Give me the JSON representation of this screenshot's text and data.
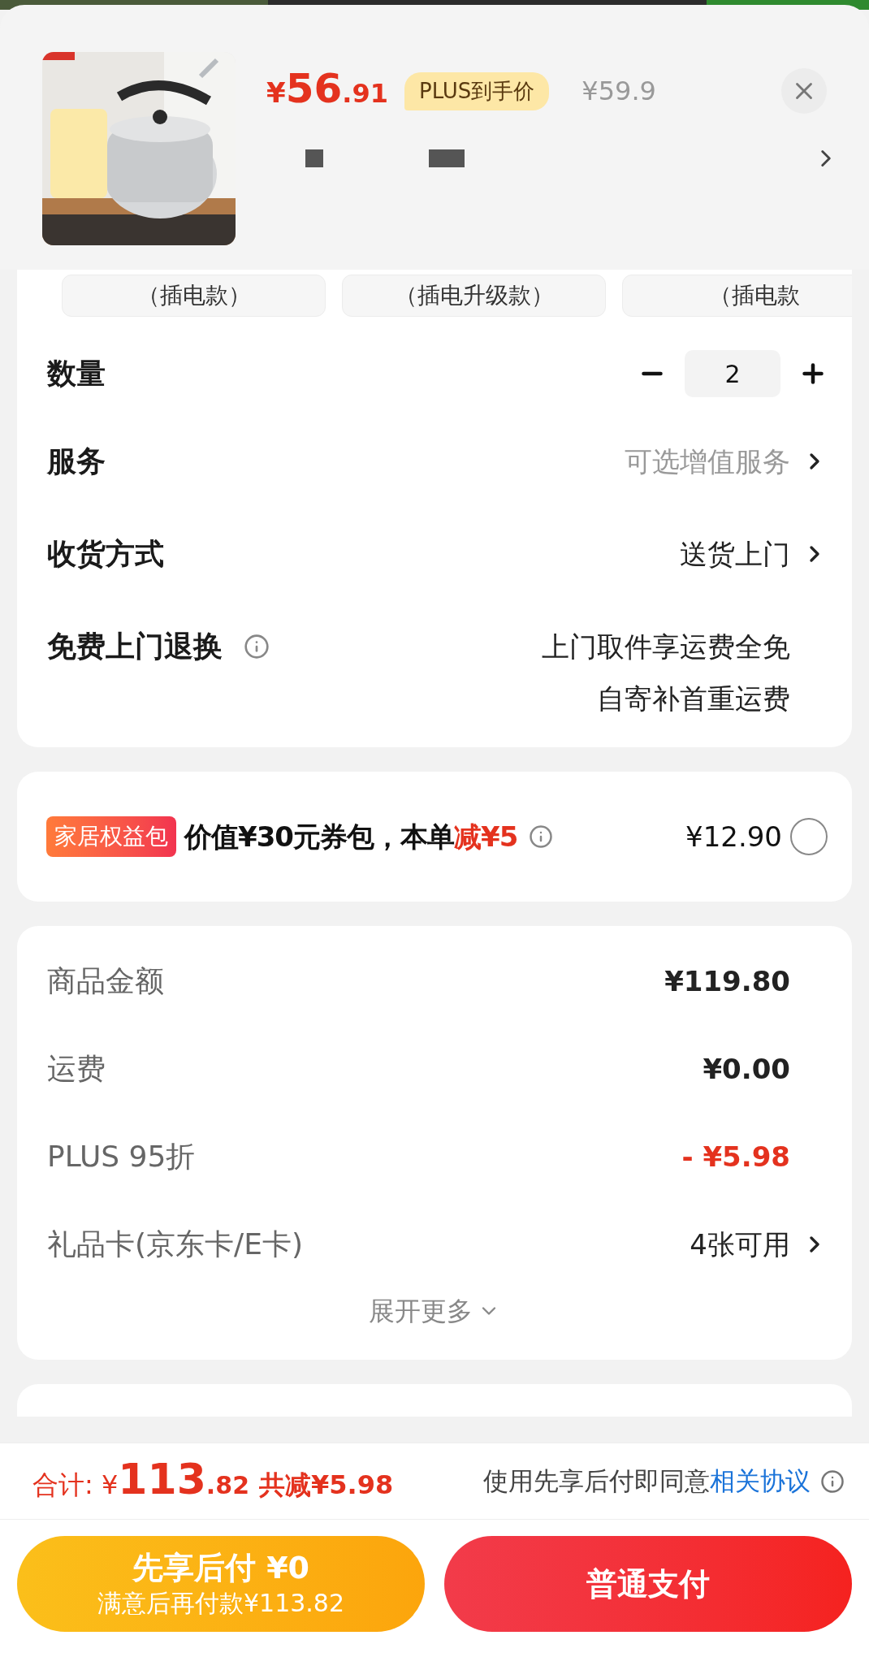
{
  "product": {
    "currency": "¥",
    "price_int": "56",
    "price_dec": ".91",
    "price_tag": "PLUS到手价",
    "original_price": "¥59.9"
  },
  "variants": [
    {
      "label": "（插电款）"
    },
    {
      "label": "（插电升级款）"
    },
    {
      "label": "（插电款"
    }
  ],
  "quantity": {
    "label": "数量",
    "value": "2"
  },
  "rows": [
    {
      "label": "服务",
      "kind": "link",
      "lines": [
        "可选增值服务"
      ],
      "muted": true
    },
    {
      "label": "收货方式",
      "kind": "link",
      "lines": [
        "送货上门"
      ],
      "muted": false
    },
    {
      "label": "免费上门退换",
      "kind": "info",
      "lines": [
        "上门取件享运费全免",
        "自寄补首重运费"
      ],
      "muted": false
    }
  ],
  "benefit": {
    "badge": "家居权益包",
    "text": "价值¥30元券包，本单",
    "highlight": "减¥5",
    "price": "¥12.90",
    "selected": false
  },
  "summary": {
    "rows": [
      {
        "label": "商品金额",
        "value": "¥119.80",
        "kind": "amount"
      },
      {
        "label": "运费",
        "value": "¥0.00",
        "kind": "amount"
      },
      {
        "label": "PLUS 95折",
        "value": "- ¥5.98",
        "kind": "discount"
      },
      {
        "label": "礼品卡(京东卡/E卡)",
        "value": "4张可用",
        "kind": "link"
      }
    ],
    "expand": "展开更多"
  },
  "footer": {
    "total_label": "合计:",
    "currency": "¥",
    "total_int": "113",
    "total_dec": ".82",
    "saved": "共减¥5.98",
    "agreement": "使用先享后付即同意",
    "agreement_link": "相关协议"
  },
  "buttons": [
    {
      "kind": "later",
      "title": "先享后付 ¥0",
      "subtitle": "满意后再付款¥113.82"
    },
    {
      "kind": "pay",
      "title": "普通支付"
    }
  ]
}
